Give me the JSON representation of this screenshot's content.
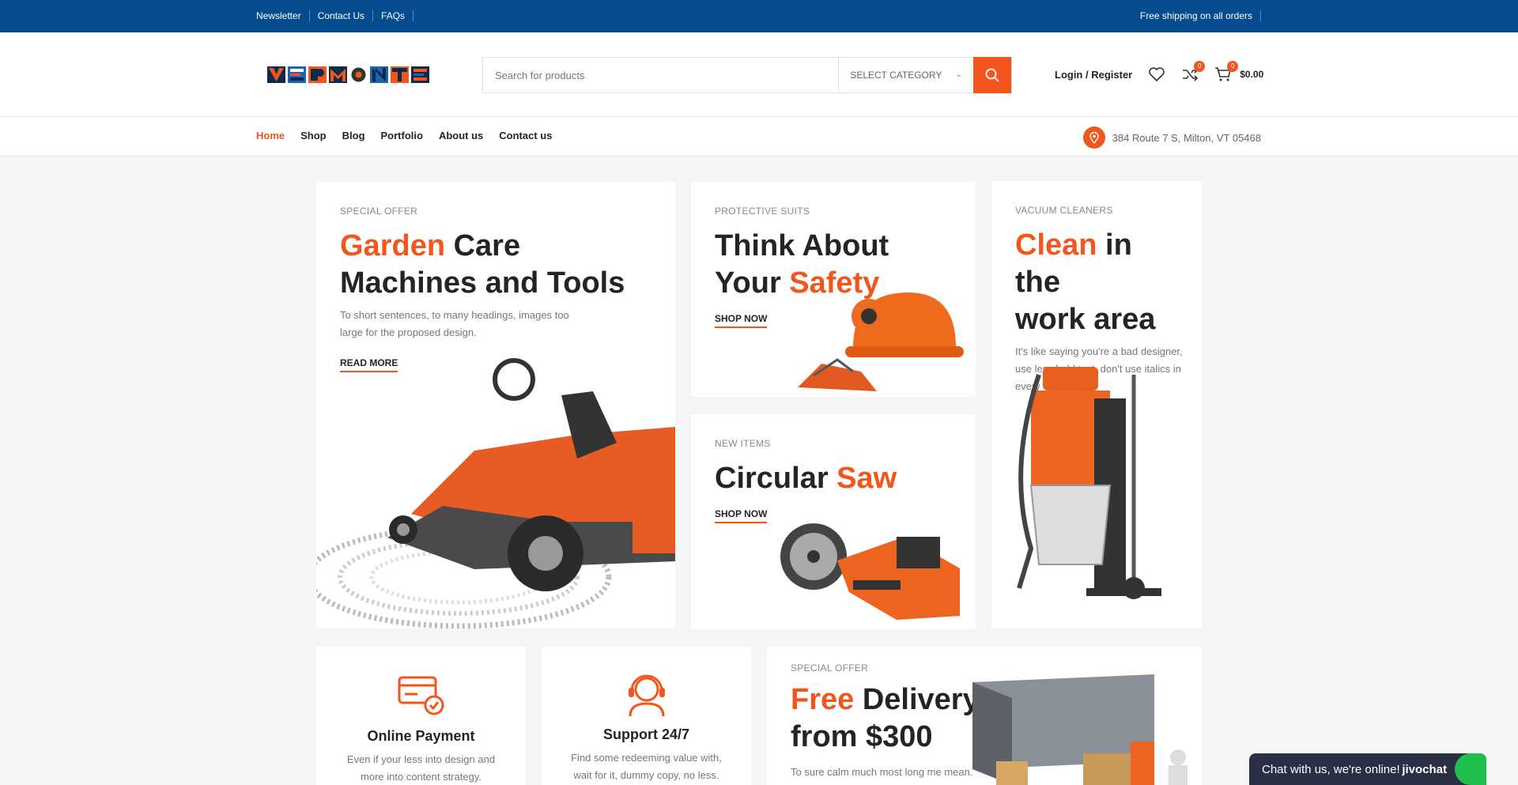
{
  "topbar": {
    "links": [
      "Newsletter",
      "Contact Us",
      "FAQs"
    ],
    "shipping_note": "Free shipping on all orders"
  },
  "header": {
    "logo_text": "VERMONTE",
    "search_placeholder": "Search for products",
    "category_label": "SELECT CATEGORY",
    "login_label": "Login / Register",
    "compare_count": "0",
    "cart_count": "0",
    "cart_total": "$0.00"
  },
  "nav": {
    "items": [
      "Home",
      "Shop",
      "Blog",
      "Portfolio",
      "About us",
      "Contact us"
    ],
    "active": "Home",
    "address": "384 Route 7 S, Milton, VT 05468"
  },
  "banners": {
    "garden": {
      "eyebrow": "SPECIAL OFFER",
      "title_accent": "Garden",
      "title_rest_1": " Care",
      "title_rest_2": "Machines and Tools",
      "text": "To short sentences, to many headings, images too large for the proposed design.",
      "link": "READ MORE"
    },
    "safety": {
      "eyebrow": "PROTECTIVE SUITS",
      "title_1": "Think About",
      "title_2": "Your ",
      "title_accent": "Safety",
      "link": "SHOP NOW"
    },
    "saw": {
      "eyebrow": "NEW ITEMS",
      "title_1": "Circular ",
      "title_accent": "Saw",
      "link": "SHOP NOW"
    },
    "vacuum": {
      "eyebrow": "VACUUM CLEANERS",
      "title_accent": "Clean",
      "title_rest_1": " in the",
      "title_rest_2": "work area",
      "text": "It's like saying you're a bad designer, use less bold text, don't use italics in every"
    },
    "delivery": {
      "eyebrow": "SPECIAL OFFER",
      "title_accent": "Free",
      "title_rest_1": " Delivery",
      "title_rest_2": "from $300",
      "text": "To sure calm much most long me mean."
    }
  },
  "features": [
    {
      "title": "Online Payment",
      "text_1": "Even if your less into design and",
      "text_2": "more into content strategy."
    },
    {
      "title": "Support 24/7",
      "text_1": "Find some redeeming value with,",
      "text_2": "wait for it, dummy copy, no less."
    }
  ],
  "chat": {
    "message": "Chat with us, we're online!",
    "brand": "jivochat"
  },
  "colors": {
    "accent": "#f2561d",
    "topbar": "#044c8e",
    "chat": "#2b2f45"
  }
}
